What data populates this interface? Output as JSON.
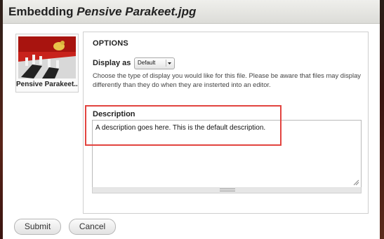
{
  "dialog": {
    "title_prefix": "Embedding ",
    "title_filename": "Pensive Parakeet.jpg"
  },
  "preview": {
    "label": "Pensive Parakeet..."
  },
  "options": {
    "heading": "OPTIONS",
    "display_label": "Display as",
    "display_value": "Default",
    "help_text": "Choose the type of display you would like for this file. Please be aware that files may display differently than they do when they are insterted into an editor.",
    "description_label": "Description",
    "description_value": "A description goes here. This is the default description."
  },
  "buttons": {
    "submit": "Submit",
    "cancel": "Cancel"
  },
  "colors": {
    "highlight": "#e2443f",
    "titlebar": "#e6e6e2"
  },
  "icons": [
    "dropdown-arrow-icon",
    "resize-corner-icon",
    "resize-grip-icon"
  ]
}
